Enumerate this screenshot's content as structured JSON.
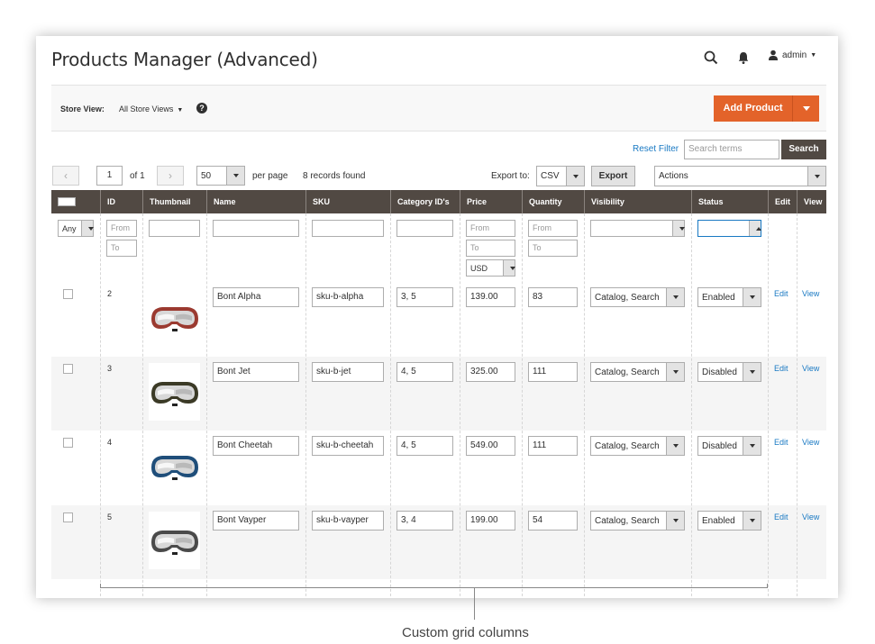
{
  "header": {
    "title": "Products Manager (Advanced)",
    "user": "admin"
  },
  "storebar": {
    "label": "Store View:",
    "value": "All Store Views",
    "help": "?",
    "add_button": "Add Product"
  },
  "search": {
    "reset": "Reset Filter",
    "placeholder": "Search terms",
    "button": "Search"
  },
  "pager": {
    "page": "1",
    "of_label": "of 1",
    "per_page_value": "50",
    "per_page_label": "per page",
    "records": "8 records found",
    "export_label": "Export to:",
    "export_format": "CSV",
    "export_button": "Export",
    "actions": "Actions"
  },
  "columns": [
    "ID",
    "Thumbnail",
    "Name",
    "SKU",
    "Category ID's",
    "Price",
    "Quantity",
    "Visibility",
    "Status",
    "Edit",
    "View"
  ],
  "filters": {
    "any": "Any",
    "from": "From",
    "to": "To",
    "currency": "USD"
  },
  "rows": [
    {
      "id": "2",
      "name": "Bont Alpha",
      "sku": "sku-b-alpha",
      "categories": "3, 5",
      "price": "139.00",
      "qty": "83",
      "visibility": "Catalog, Search",
      "status": "Enabled",
      "edit": "Edit",
      "view": "View",
      "goggle_color": "#9b3a30"
    },
    {
      "id": "3",
      "name": "Bont Jet",
      "sku": "sku-b-jet",
      "categories": "4, 5",
      "price": "325.00",
      "qty": "111",
      "visibility": "Catalog, Search",
      "status": "Disabled",
      "edit": "Edit",
      "view": "View",
      "goggle_color": "#3b3a26"
    },
    {
      "id": "4",
      "name": "Bont Cheetah",
      "sku": "sku-b-cheetah",
      "categories": "4, 5",
      "price": "549.00",
      "qty": "111",
      "visibility": "Catalog, Search",
      "status": "Disabled",
      "edit": "Edit",
      "view": "View",
      "goggle_color": "#1f4e7a"
    },
    {
      "id": "5",
      "name": "Bont Vayper",
      "sku": "sku-b-vayper",
      "categories": "3, 4",
      "price": "199.00",
      "qty": "54",
      "visibility": "Catalog, Search",
      "status": "Enabled",
      "edit": "Edit",
      "view": "View",
      "goggle_color": "#4a4a4a"
    }
  ],
  "caption": "Custom grid columns",
  "colors": {
    "accent": "#e3632a",
    "header_bg": "#514943",
    "link": "#1979c3"
  }
}
